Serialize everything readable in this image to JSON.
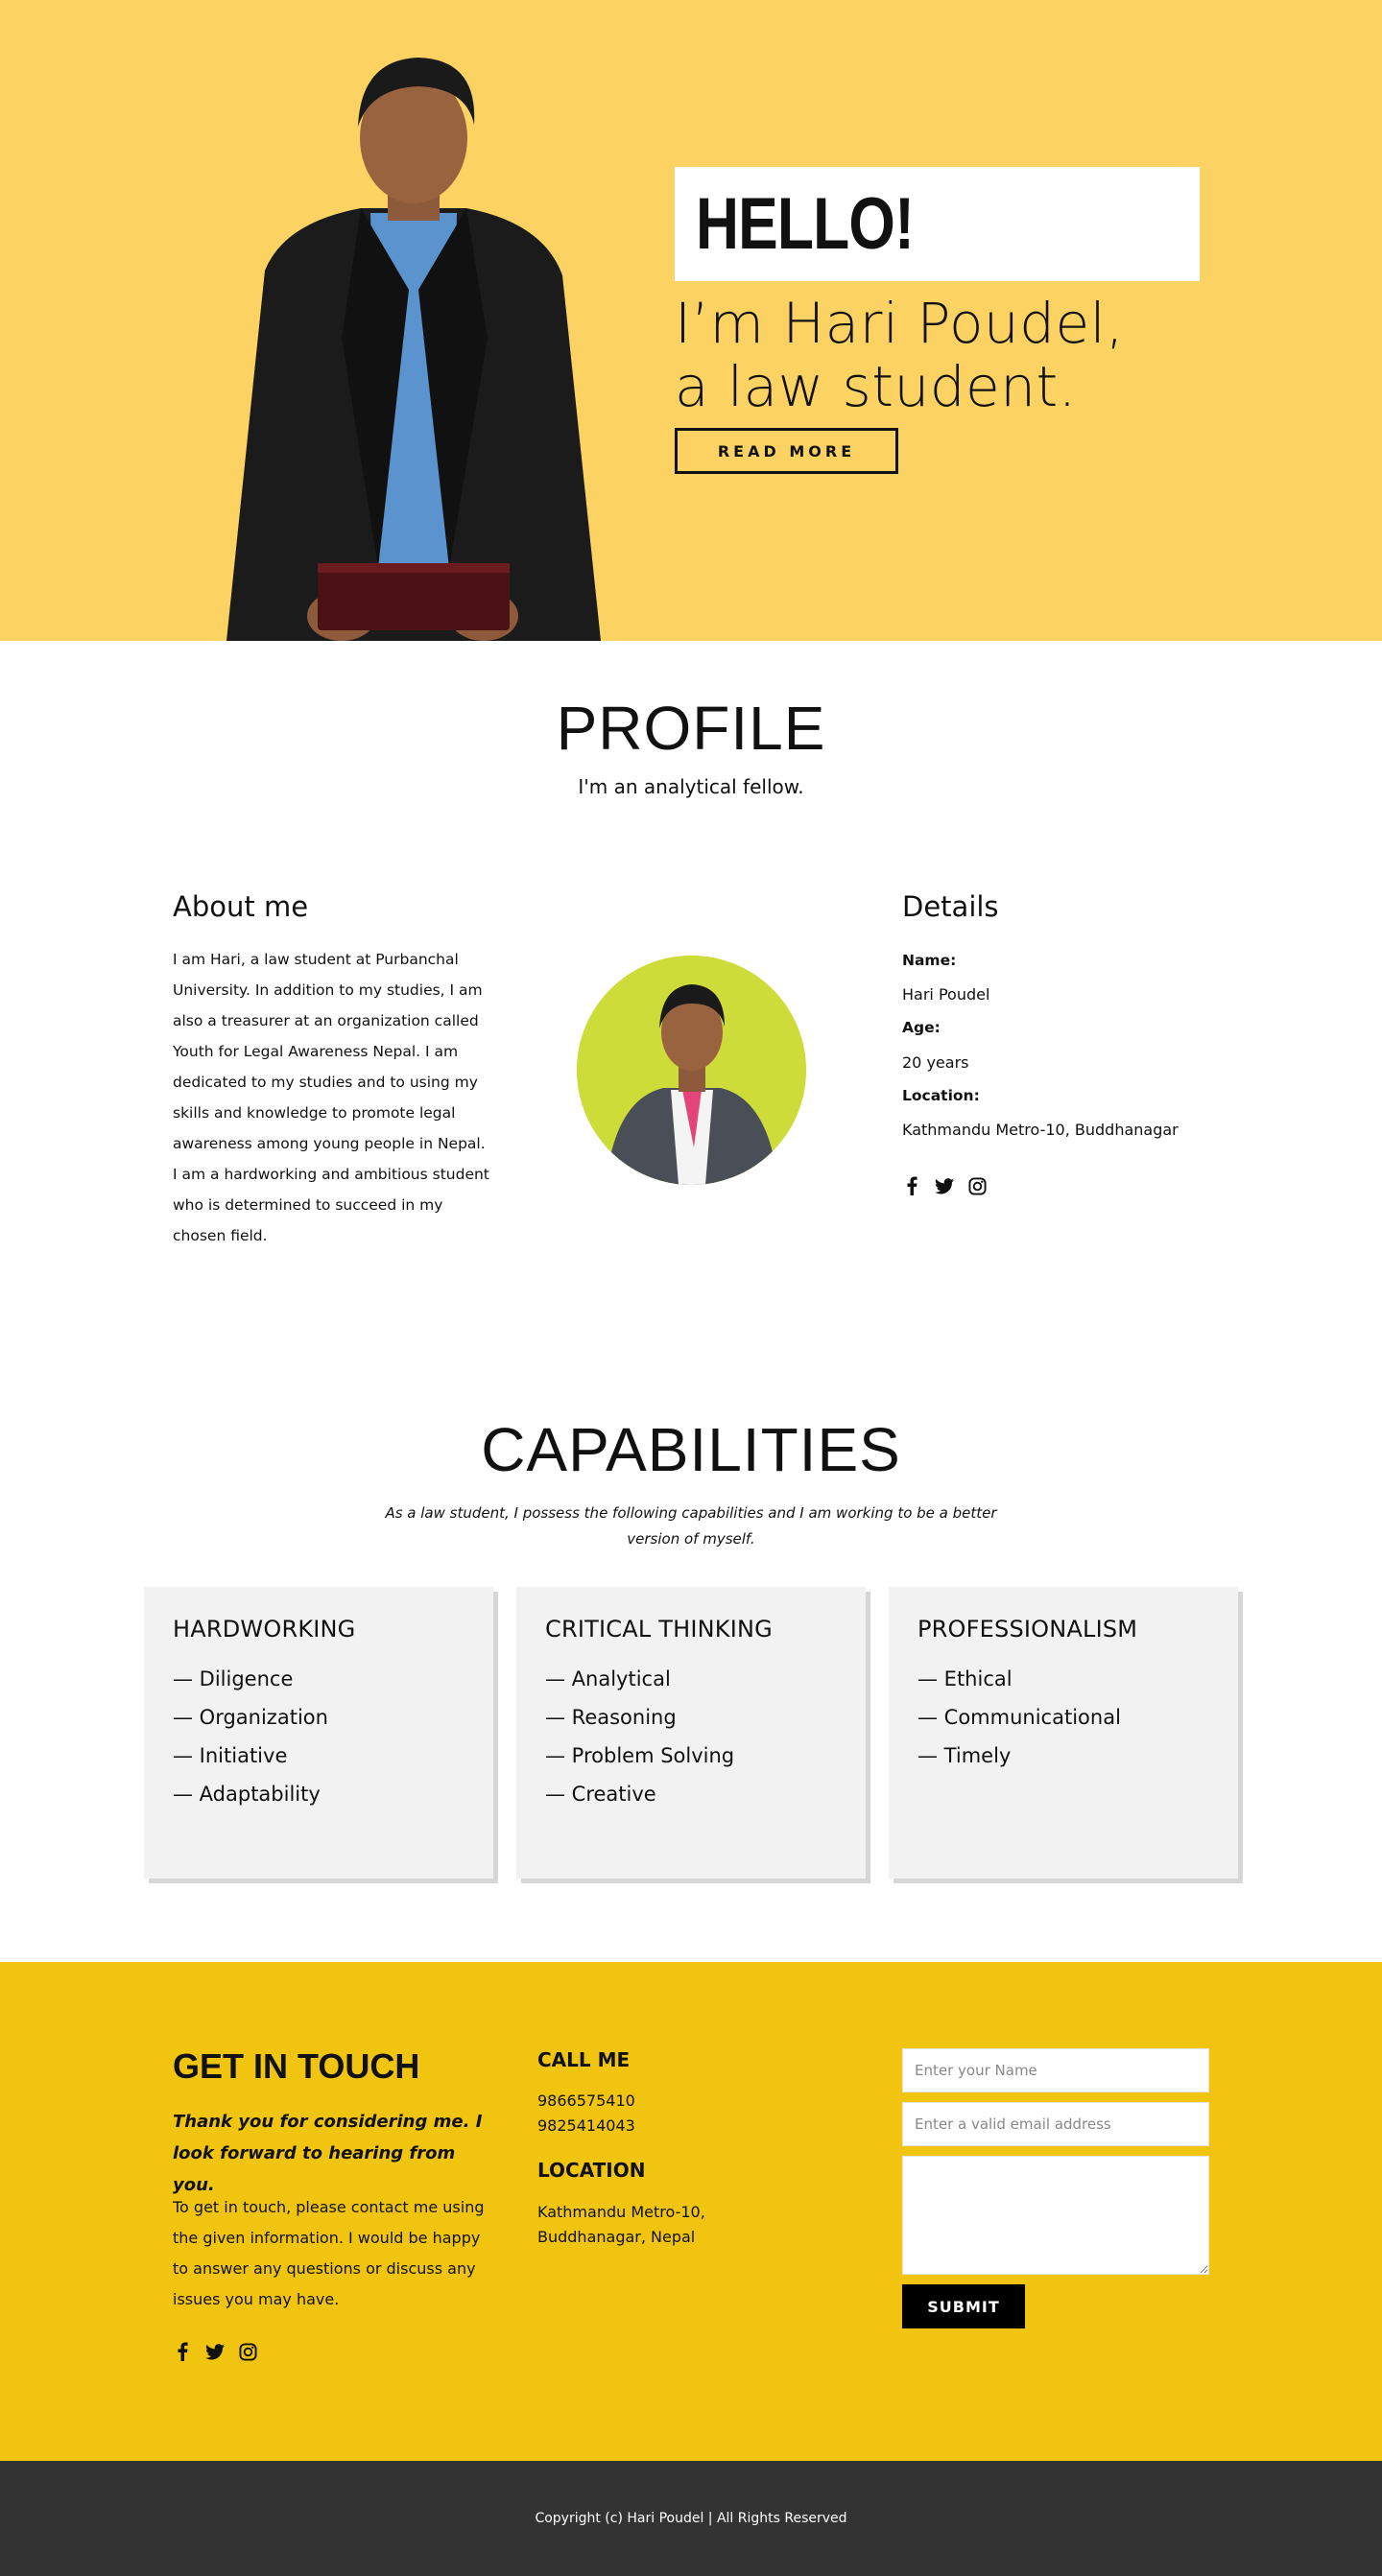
{
  "hero": {
    "hello": "HELLO!",
    "intro_line1": "I’m Hari Poudel,",
    "intro_line2": "a law student.",
    "read_more": "READ MORE",
    "colors": {
      "background": "#fcd363"
    }
  },
  "profile": {
    "title": "PROFILE",
    "subtitle": "I'm an analytical fellow.",
    "about": {
      "title": "About me",
      "text": "I am Hari, a law student at Purbanchal University. In addition to my studies, I am also a treasurer at an organization called Youth for Legal Awareness Nepal. I am dedicated to my studies and to using my skills and knowledge to promote legal awareness among young people in Nepal. I am a hardworking and ambitious student who is determined to succeed in my chosen field."
    },
    "details": {
      "title": "Details",
      "name_label": "Name:",
      "name": "Hari Poudel",
      "age_label": "Age:",
      "age": "20 years",
      "location_label": "Location:",
      "location": "Kathmandu Metro-10, Buddhanagar"
    },
    "social": [
      "facebook-icon",
      "twitter-icon",
      "instagram-icon"
    ]
  },
  "capabilities": {
    "title": "CAPABILITIES",
    "subtitle": "As a law student, I possess the following capabilities and I am working to be a better version of myself.",
    "cards": [
      {
        "title": "HARDWORKING",
        "items": [
          "— Diligence",
          "— Organization",
          "— Initiative",
          "— Adaptability"
        ]
      },
      {
        "title": "CRITICAL THINKING",
        "items": [
          "— Analytical",
          "— Reasoning",
          "— Problem Solving",
          "— Creative"
        ]
      },
      {
        "title": "PROFESSIONALISM",
        "items": [
          "— Ethical",
          "— Communicational",
          "— Timely"
        ]
      }
    ]
  },
  "contact": {
    "title": "GET IN TOUCH",
    "lead": "Thank you for considering me. I look forward to hearing from you.",
    "text": "To get in touch, please contact me using the given information. I would be happy to answer any questions or discuss any issues you may have.",
    "call_title": "CALL ME",
    "phone1": "9866575410",
    "phone2": "9825414043",
    "location_title": "LOCATION",
    "location_line1": "Kathmandu Metro-10,",
    "location_line2": "Buddhanagar, Nepal",
    "name_placeholder": "Enter your Name",
    "email_placeholder": "Enter a valid email address",
    "submit": "SUBMIT",
    "colors": {
      "background": "#f0c40f"
    }
  },
  "footer": {
    "copyright": "Copyright (c) Hari Poudel | All Rights Reserved"
  }
}
